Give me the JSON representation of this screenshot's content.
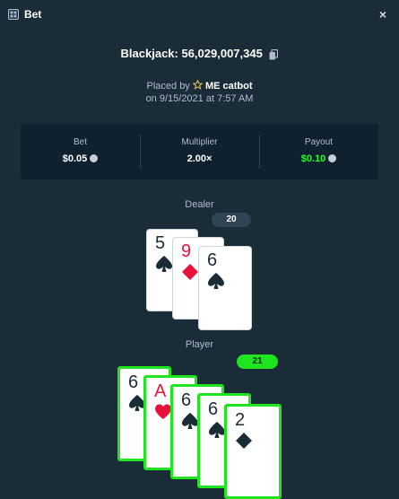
{
  "header": {
    "title": "Bet",
    "close": "×"
  },
  "bet": {
    "id_label": "Blackjack: 56,029,007,345",
    "placed_by_prefix": "Placed by",
    "user": "ME catbot",
    "date": "on 9/15/2021 at 7:57 AM"
  },
  "stats": {
    "bet_label": "Bet",
    "bet_value": "$0.05",
    "multiplier_label": "Multiplier",
    "multiplier_value": "2.00×",
    "payout_label": "Payout",
    "payout_value": "$0.10"
  },
  "dealer": {
    "label": "Dealer",
    "score": "20",
    "cards": [
      {
        "rank": "5",
        "suit": "spade"
      },
      {
        "rank": "9",
        "suit": "diamond"
      },
      {
        "rank": "6",
        "suit": "spade"
      }
    ]
  },
  "player": {
    "label": "Player",
    "score": "21",
    "cards": [
      {
        "rank": "6",
        "suit": "spade"
      },
      {
        "rank": "A",
        "suit": "heart"
      },
      {
        "rank": "6",
        "suit": "spade"
      },
      {
        "rank": "6",
        "suit": "spade"
      },
      {
        "rank": "2",
        "suit": "diamond"
      }
    ]
  },
  "colors": {
    "background": "#1a2c38",
    "panel": "#0f212e",
    "win": "#1fe51f",
    "red_suit": "#e9113c"
  }
}
